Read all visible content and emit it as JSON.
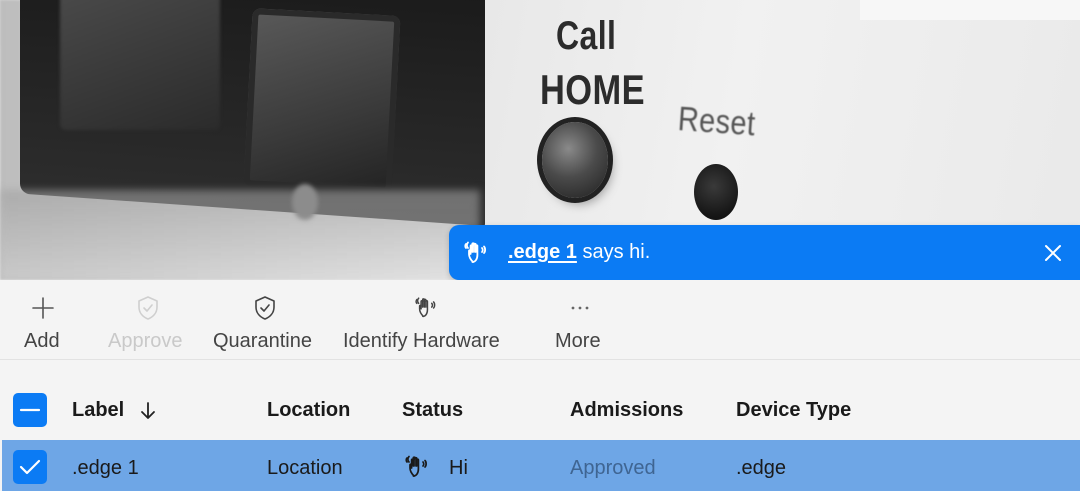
{
  "photo": {
    "engraved": {
      "call": "Call",
      "home": "HOME",
      "reset": "Reset"
    }
  },
  "toast": {
    "device_link": ".edge 1",
    "message": "says hi.",
    "icon": "waving-hand-icon",
    "close_icon": "close-icon",
    "background": "#0b7bf4"
  },
  "toolbar": {
    "add": {
      "label": "Add",
      "icon": "plus-icon",
      "enabled": true
    },
    "approve": {
      "label": "Approve",
      "icon": "shield-check-icon",
      "enabled": false
    },
    "quarantine": {
      "label": "Quarantine",
      "icon": "shield-check-icon",
      "enabled": true
    },
    "identify": {
      "label": "Identify Hardware",
      "icon": "waving-hand-icon",
      "enabled": true
    },
    "more": {
      "label": "More",
      "icon": "ellipsis-icon",
      "enabled": true
    }
  },
  "table": {
    "columns": [
      "Label",
      "Location",
      "Status",
      "Admissions",
      "Device Type"
    ],
    "sort": {
      "column": "Label",
      "direction": "descending"
    },
    "select_all_state": "indeterminate",
    "rows": [
      {
        "selected": true,
        "label": ".edge 1",
        "location": "Location",
        "status": "Hi",
        "status_icon": "waving-hand-icon",
        "admissions": "Approved",
        "device_type": ".edge"
      }
    ]
  },
  "colors": {
    "accent": "#0b7bf4",
    "selected_row": "#6ea6e6",
    "disabled_text": "#c9c9c9"
  }
}
